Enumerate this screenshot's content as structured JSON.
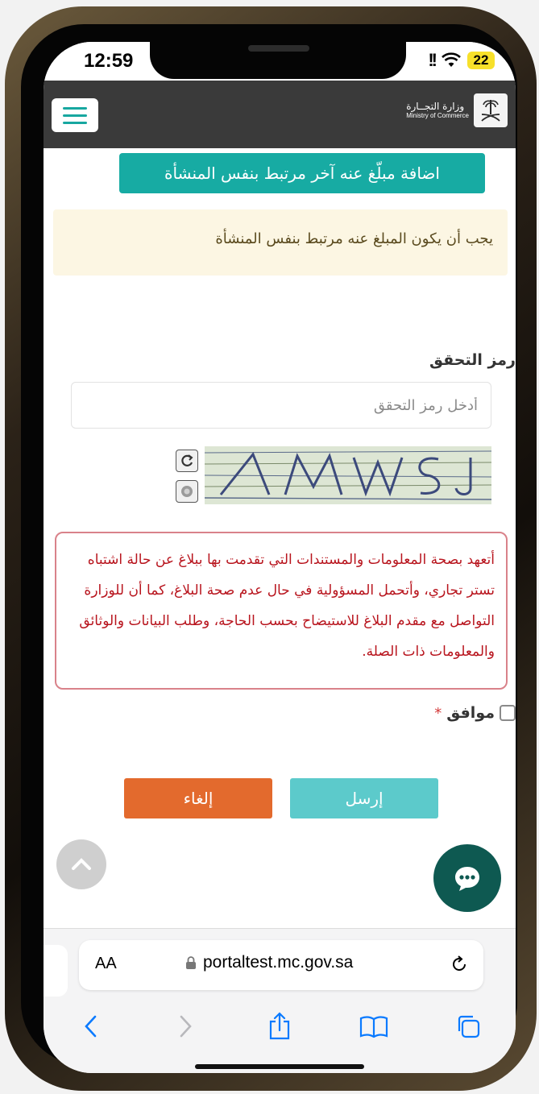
{
  "status_bar": {
    "time": "12:59",
    "signal": "!!",
    "battery": "22"
  },
  "header": {
    "logo_ar": "وزارة التجــارة",
    "logo_en": "Ministry of Commerce",
    "menu_icon": "hamburger-icon"
  },
  "form": {
    "add_reported_button": "اضافة مبلّغ عنه آخر مرتبط بنفس المنشأة",
    "warning_text": "يجب أن يكون المبلغ عنه مرتبط بنفس المنشأة",
    "captcha_label": "رمز التحقق",
    "captcha_placeholder": "أدخل رمز التحقق",
    "captcha_value": "",
    "captcha_image_text": "4MWSJ",
    "pledge_text": "أتعهد بصحة المعلومات والمستندات التي تقدمت بها ببلاغ عن حالة اشتباه تستر تجاري، وأتحمل المسؤولية في حال عدم صحة البلاغ، كما أن للوزارة التواصل مع مقدم البلاغ للاستيضاح بحسب الحاجة، وطلب البيانات والوثائق والمعلومات ذات الصلة.",
    "agree_label": "موافق",
    "required_mark": "*",
    "agree_checked": false,
    "submit_label": "إرسل",
    "cancel_label": "إلغاء"
  },
  "browser": {
    "aa_label": "AA",
    "url": "portaltest.mc.gov.sa"
  },
  "colors": {
    "teal": "#17aba3",
    "submit": "#5ccacb",
    "cancel": "#e36a2d",
    "chat": "#0e5951",
    "pledge_red": "#b8141d",
    "warning_bg": "#fcf6e3"
  }
}
